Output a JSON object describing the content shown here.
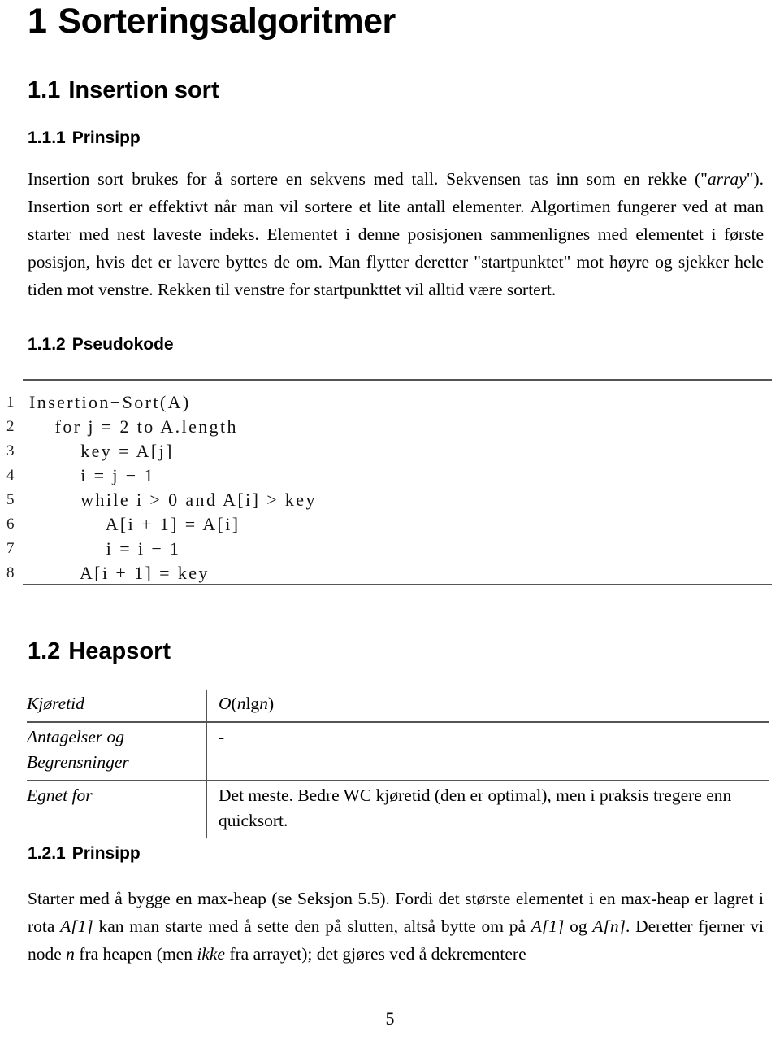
{
  "document": {
    "chapter": {
      "number": "1",
      "title": "Sorteringsalgoritmer"
    },
    "sections": {
      "insertion_sort": {
        "number": "1.1",
        "title": "Insertion sort",
        "prinsipp": {
          "number": "1.1.1",
          "title": "Prinsipp",
          "paragraph_part1": "Insertion sort brukes for å sortere en sekvens med tall. Sekvensen tas inn som en rekke (\"",
          "paragraph_emph1": "array",
          "paragraph_part2": "\"). Insertion sort er effektivt når man vil sortere et lite antall elementer. Algortimen fungerer ved at man starter med nest laveste indeks. Elementet i denne posisjonen sammenlignes med elementet i første posisjon, hvis det er lavere byttes de om. Man flytter deretter \"startpunktet\" mot høyre og sjekker hele tiden mot venstre. Rekken til venstre for startpunkttet vil alltid være sortert."
        },
        "pseudokode": {
          "number": "1.1.2",
          "title": "Pseudokode",
          "code_lines": [
            {
              "n": "1",
              "text": "Insertion−Sort(A)"
            },
            {
              "n": "2",
              "text": "    for j = 2 to A.length"
            },
            {
              "n": "3",
              "text": "        key = A[j]"
            },
            {
              "n": "4",
              "text": "        i = j − 1"
            },
            {
              "n": "5",
              "text": "        while i > 0 and A[i] > key"
            },
            {
              "n": "6",
              "text": "            A[i + 1] = A[i]"
            },
            {
              "n": "7",
              "text": "            i = i − 1"
            },
            {
              "n": "8",
              "text": "        A[i + 1] = key"
            }
          ]
        }
      },
      "heapsort": {
        "number": "1.2",
        "title": "Heapsort",
        "table": {
          "rows": [
            {
              "label": "Kjøretid",
              "value": "O(n lg n)",
              "value_is_math": true
            },
            {
              "label": "Antagelser og Begrensninger",
              "label_line1": "Antagelser og",
              "label_line2": "Begrensninger",
              "value": "-"
            },
            {
              "label": "Egnet for",
              "value": "Det meste. Bedre WC kjøretid (den er optimal), men i praksis tregere enn quicksort."
            }
          ]
        },
        "prinsipp": {
          "number": "1.2.1",
          "title": "Prinsipp",
          "paragraph_part1": "Starter med å bygge en max-heap (se Seksjon 5.5). Fordi det største elementet i en max-heap er lagret i rota ",
          "paragraph_emph1": "A[1]",
          "paragraph_part2": " kan man starte med å sette den på slutten, altså bytte om på ",
          "paragraph_emph2": "A[1]",
          "paragraph_part3": " og ",
          "paragraph_emph3": "A[n]",
          "paragraph_part4": ". Deretter fjerner vi node ",
          "paragraph_emph4": "n",
          "paragraph_part5": " fra heapen (men ",
          "paragraph_emph5": "ikke",
          "paragraph_part6": " fra arrayet); det gjøres ved å dekrementere"
        }
      }
    },
    "footer": {
      "page_number": "5"
    },
    "formula": {
      "o_open": "O",
      "paren_open": "(",
      "n1": "n",
      "lg": "lg",
      "n2": "n",
      "paren_close": ")"
    }
  }
}
